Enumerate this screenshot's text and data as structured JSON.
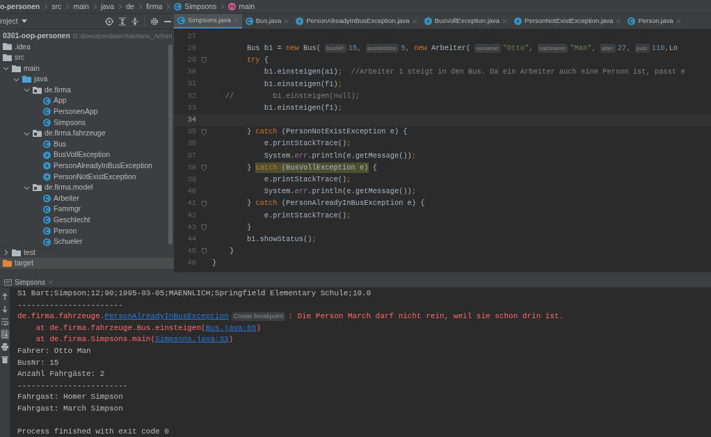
{
  "breadcrumbs": [
    {
      "label": "o-personen",
      "kind": "project"
    },
    {
      "label": "src",
      "kind": "folder"
    },
    {
      "label": "main",
      "kind": "folder"
    },
    {
      "label": "java",
      "kind": "folder"
    },
    {
      "label": "de",
      "kind": "folder"
    },
    {
      "label": "firma",
      "kind": "folder"
    },
    {
      "label": "Simpsons",
      "kind": "class"
    },
    {
      "label": "main",
      "kind": "method"
    }
  ],
  "project_panel": {
    "title": "roject",
    "root": {
      "name": "0301-oop-personen",
      "path": "D:\\Benutzerdaten\\Mertens_Achim"
    },
    "tree": [
      {
        "label": ".idea",
        "kind": "folder",
        "selected": false
      },
      {
        "label": "src",
        "kind": "folder",
        "selected": false
      },
      {
        "label": "main",
        "kind": "folder",
        "expanded": true,
        "selected": false,
        "children": [
          {
            "label": "java",
            "kind": "source-folder",
            "expanded": true,
            "selected": false,
            "children": [
              {
                "label": "de.firma",
                "kind": "package",
                "expanded": true,
                "selected": false,
                "children": [
                  {
                    "label": "App",
                    "kind": "class",
                    "selected": false
                  },
                  {
                    "label": "PersonenApp",
                    "kind": "class",
                    "selected": false
                  },
                  {
                    "label": "Simpsons",
                    "kind": "class",
                    "selected": false
                  }
                ]
              },
              {
                "label": "de.firma.fahrzeuge",
                "kind": "package",
                "expanded": true,
                "selected": false,
                "children": [
                  {
                    "label": "Bus",
                    "kind": "class",
                    "selected": false
                  },
                  {
                    "label": "BusVollException",
                    "kind": "exception",
                    "selected": false
                  },
                  {
                    "label": "PersonAlreadyInBusException",
                    "kind": "exception",
                    "selected": false
                  },
                  {
                    "label": "PersonNotExistException",
                    "kind": "exception",
                    "selected": false
                  }
                ]
              },
              {
                "label": "de.firma.model",
                "kind": "package",
                "expanded": true,
                "selected": false,
                "children": [
                  {
                    "label": "Arbeiter",
                    "kind": "class",
                    "selected": false
                  },
                  {
                    "label": "Fammgr",
                    "kind": "class",
                    "selected": false
                  },
                  {
                    "label": "Geschlecht",
                    "kind": "class",
                    "selected": false
                  },
                  {
                    "label": "Person",
                    "kind": "class",
                    "selected": false
                  },
                  {
                    "label": "Schueler",
                    "kind": "class",
                    "selected": false
                  }
                ]
              }
            ]
          }
        ]
      },
      {
        "label": "test",
        "kind": "folder",
        "expanded": false,
        "selected": false
      },
      {
        "label": "target",
        "kind": "excluded-folder",
        "selected": true
      }
    ]
  },
  "editor": {
    "tabs": [
      {
        "label": "Simpsons.java",
        "kind": "class",
        "selected": true
      },
      {
        "label": "Bus.java",
        "kind": "class",
        "selected": false
      },
      {
        "label": "PersonAlreadyInBusException.java",
        "kind": "exception",
        "selected": false
      },
      {
        "label": "BusVollException.java",
        "kind": "exception",
        "selected": false
      },
      {
        "label": "PersonNotExistException.java",
        "kind": "exception",
        "selected": false
      },
      {
        "label": "Person.java",
        "kind": "class",
        "selected": false
      }
    ],
    "lines": [
      {
        "number": "27",
        "current": false,
        "fold": false
      },
      {
        "number": "28",
        "current": false,
        "fold": false,
        "tokens": [
          {
            "kind": "plain",
            "text": "        Bus b1 = "
          },
          {
            "kind": "keyword",
            "text": "new"
          },
          {
            "kind": "plain",
            "text": " Bus( "
          },
          {
            "kind": "hint",
            "text": "busNR:"
          },
          {
            "kind": "number",
            "text": "15"
          },
          {
            "kind": "punct",
            "text": ", "
          },
          {
            "kind": "hint",
            "text": "anzahlSitze:"
          },
          {
            "kind": "number",
            "text": "5"
          },
          {
            "kind": "punct",
            "text": ", "
          },
          {
            "kind": "keyword",
            "text": "new"
          },
          {
            "kind": "plain",
            "text": " Arbeiter( "
          },
          {
            "kind": "hint",
            "text": "vorname:"
          },
          {
            "kind": "string",
            "text": "\"Otto\""
          },
          {
            "kind": "punct",
            "text": ", "
          },
          {
            "kind": "hint",
            "text": "nachname:"
          },
          {
            "kind": "string",
            "text": "\"Man\""
          },
          {
            "kind": "punct",
            "text": ", "
          },
          {
            "kind": "hint",
            "text": "alter:"
          },
          {
            "kind": "number",
            "text": "27"
          },
          {
            "kind": "punct",
            "text": ", "
          },
          {
            "kind": "hint",
            "text": "puls:"
          },
          {
            "kind": "number",
            "text": "110"
          },
          {
            "kind": "punct",
            "text": ","
          },
          {
            "kind": "plain",
            "text": "Lo"
          }
        ]
      },
      {
        "number": "29",
        "current": false,
        "fold": true,
        "tokens": [
          {
            "kind": "keyword",
            "text": "        try"
          },
          {
            "kind": "plain",
            "text": " {"
          }
        ]
      },
      {
        "number": "30",
        "current": false,
        "fold": false,
        "tokens": [
          {
            "kind": "plain",
            "text": "            b1.einsteigen(a1)"
          },
          {
            "kind": "punct",
            "text": ";"
          },
          {
            "kind": "comment",
            "text": "  //Arbeiter 1 steigt in den Bus. Da ein Arbeiter auch eine Person ist, passt e"
          }
        ]
      },
      {
        "number": "31",
        "current": false,
        "fold": false,
        "tokens": [
          {
            "kind": "plain",
            "text": "            b1.einsteigen(f1)"
          },
          {
            "kind": "punct",
            "text": ";"
          }
        ]
      },
      {
        "number": "32",
        "current": false,
        "fold": false,
        "tokens": [
          {
            "kind": "comment",
            "text": "   //         b1.einsteigen(null);"
          }
        ]
      },
      {
        "number": "33",
        "current": false,
        "fold": false,
        "tokens": [
          {
            "kind": "plain",
            "text": "            b1.einsteigen(f1)"
          },
          {
            "kind": "punct",
            "text": ";"
          }
        ]
      },
      {
        "number": "34",
        "current": true,
        "fold": false
      },
      {
        "number": "35",
        "current": false,
        "fold": true,
        "tokens": [
          {
            "kind": "plain",
            "text": "        } "
          },
          {
            "kind": "keyword",
            "text": "catch"
          },
          {
            "kind": "plain",
            "text": " (PersonNotExistException e) {"
          }
        ]
      },
      {
        "number": "36",
        "current": false,
        "fold": false,
        "tokens": [
          {
            "kind": "plain",
            "text": "            e.printStackTrace()"
          },
          {
            "kind": "punct",
            "text": ";"
          }
        ]
      },
      {
        "number": "37",
        "current": false,
        "fold": false,
        "tokens": [
          {
            "kind": "plain",
            "text": "            System."
          },
          {
            "kind": "field",
            "text": "err"
          },
          {
            "kind": "plain",
            "text": ".println(e.getMessage())"
          },
          {
            "kind": "punct",
            "text": ";"
          }
        ]
      },
      {
        "number": "38",
        "current": false,
        "fold": true,
        "tokens": [
          {
            "kind": "plain",
            "text": "        } "
          },
          {
            "kind": "match-keyword",
            "text": "catch"
          },
          {
            "kind": "match",
            "text": " (BusVollException e)"
          },
          {
            "kind": "plain",
            "text": " {"
          }
        ]
      },
      {
        "number": "39",
        "current": false,
        "fold": false,
        "tokens": [
          {
            "kind": "plain",
            "text": "            e.printStackTrace()"
          },
          {
            "kind": "punct",
            "text": ";"
          }
        ]
      },
      {
        "number": "40",
        "current": false,
        "fold": false,
        "tokens": [
          {
            "kind": "plain",
            "text": "            System."
          },
          {
            "kind": "field",
            "text": "err"
          },
          {
            "kind": "plain",
            "text": ".println(e.getMessage())"
          },
          {
            "kind": "punct",
            "text": ";"
          }
        ]
      },
      {
        "number": "41",
        "current": false,
        "fold": true,
        "tokens": [
          {
            "kind": "plain",
            "text": "        } "
          },
          {
            "kind": "keyword",
            "text": "catch"
          },
          {
            "kind": "plain",
            "text": " (PersonAlreadyInBusException e) {"
          }
        ]
      },
      {
        "number": "42",
        "current": false,
        "fold": false,
        "tokens": [
          {
            "kind": "plain",
            "text": "            e.printStackTrace()"
          },
          {
            "kind": "punct",
            "text": ";"
          }
        ]
      },
      {
        "number": "43",
        "current": false,
        "fold": true,
        "tokens": [
          {
            "kind": "plain",
            "text": "        }"
          }
        ]
      },
      {
        "number": "44",
        "current": false,
        "fold": false,
        "tokens": [
          {
            "kind": "plain",
            "text": "        b1.showStatus()"
          },
          {
            "kind": "punct",
            "text": ";"
          }
        ]
      },
      {
        "number": "45",
        "current": false,
        "fold": true,
        "tokens": [
          {
            "kind": "plain",
            "text": "    }"
          }
        ]
      },
      {
        "number": "46",
        "current": false,
        "fold": false,
        "tokens": [
          {
            "kind": "plain",
            "text": "}"
          }
        ]
      }
    ]
  },
  "run_panel": {
    "tab": "Simpsons",
    "toolbar": [
      {
        "kind": "up",
        "selected": false
      },
      {
        "kind": "down",
        "selected": false
      },
      {
        "kind": "wrap",
        "selected": false
      },
      {
        "kind": "scroll-end",
        "selected": true
      },
      {
        "kind": "print",
        "selected": false
      },
      {
        "kind": "trash",
        "selected": false
      }
    ],
    "lines": [
      {
        "segments": [
          {
            "kind": "out",
            "text": "S1 Bart;Simpson;12;90;1995-03-05;MAENNLICH;Springfield Elementary Schule;10.0"
          }
        ]
      },
      {
        "segments": [
          {
            "kind": "out",
            "text": "-----------------------"
          }
        ]
      },
      {
        "segments": [
          {
            "kind": "err",
            "text": "de.firma.fahrzeuge."
          },
          {
            "kind": "link",
            "text": "PersonAlreadyInBusException"
          },
          {
            "kind": "hint",
            "text": "Create breakpoint"
          },
          {
            "kind": "err",
            "text": ": Die Person March darf nicht rein, weil sie schon drin ist."
          }
        ]
      },
      {
        "segments": [
          {
            "kind": "err",
            "text": "    at de.firma.fahrzeuge.Bus.einsteigen("
          },
          {
            "kind": "link",
            "text": "Bus.java:65"
          },
          {
            "kind": "err",
            "text": ")"
          }
        ]
      },
      {
        "segments": [
          {
            "kind": "err",
            "text": "    at de.firma.Simpsons.main("
          },
          {
            "kind": "link",
            "text": "Simpsons.java:33"
          },
          {
            "kind": "err",
            "text": ")"
          }
        ]
      },
      {
        "segments": [
          {
            "kind": "out",
            "text": "Fahrer: Otto Man"
          }
        ]
      },
      {
        "segments": [
          {
            "kind": "out",
            "text": "BusNr: 15"
          }
        ]
      },
      {
        "segments": [
          {
            "kind": "out",
            "text": "Anzahl Fahrgäste: 2"
          }
        ]
      },
      {
        "segments": [
          {
            "kind": "out",
            "text": "------------------------"
          }
        ]
      },
      {
        "segments": [
          {
            "kind": "out",
            "text": "Fahrgast: Homer Simpson"
          }
        ]
      },
      {
        "segments": [
          {
            "kind": "out",
            "text": "Fahrgast: March Simpson"
          }
        ]
      }
    ],
    "exit_message": "Process finished with exit code 0"
  }
}
